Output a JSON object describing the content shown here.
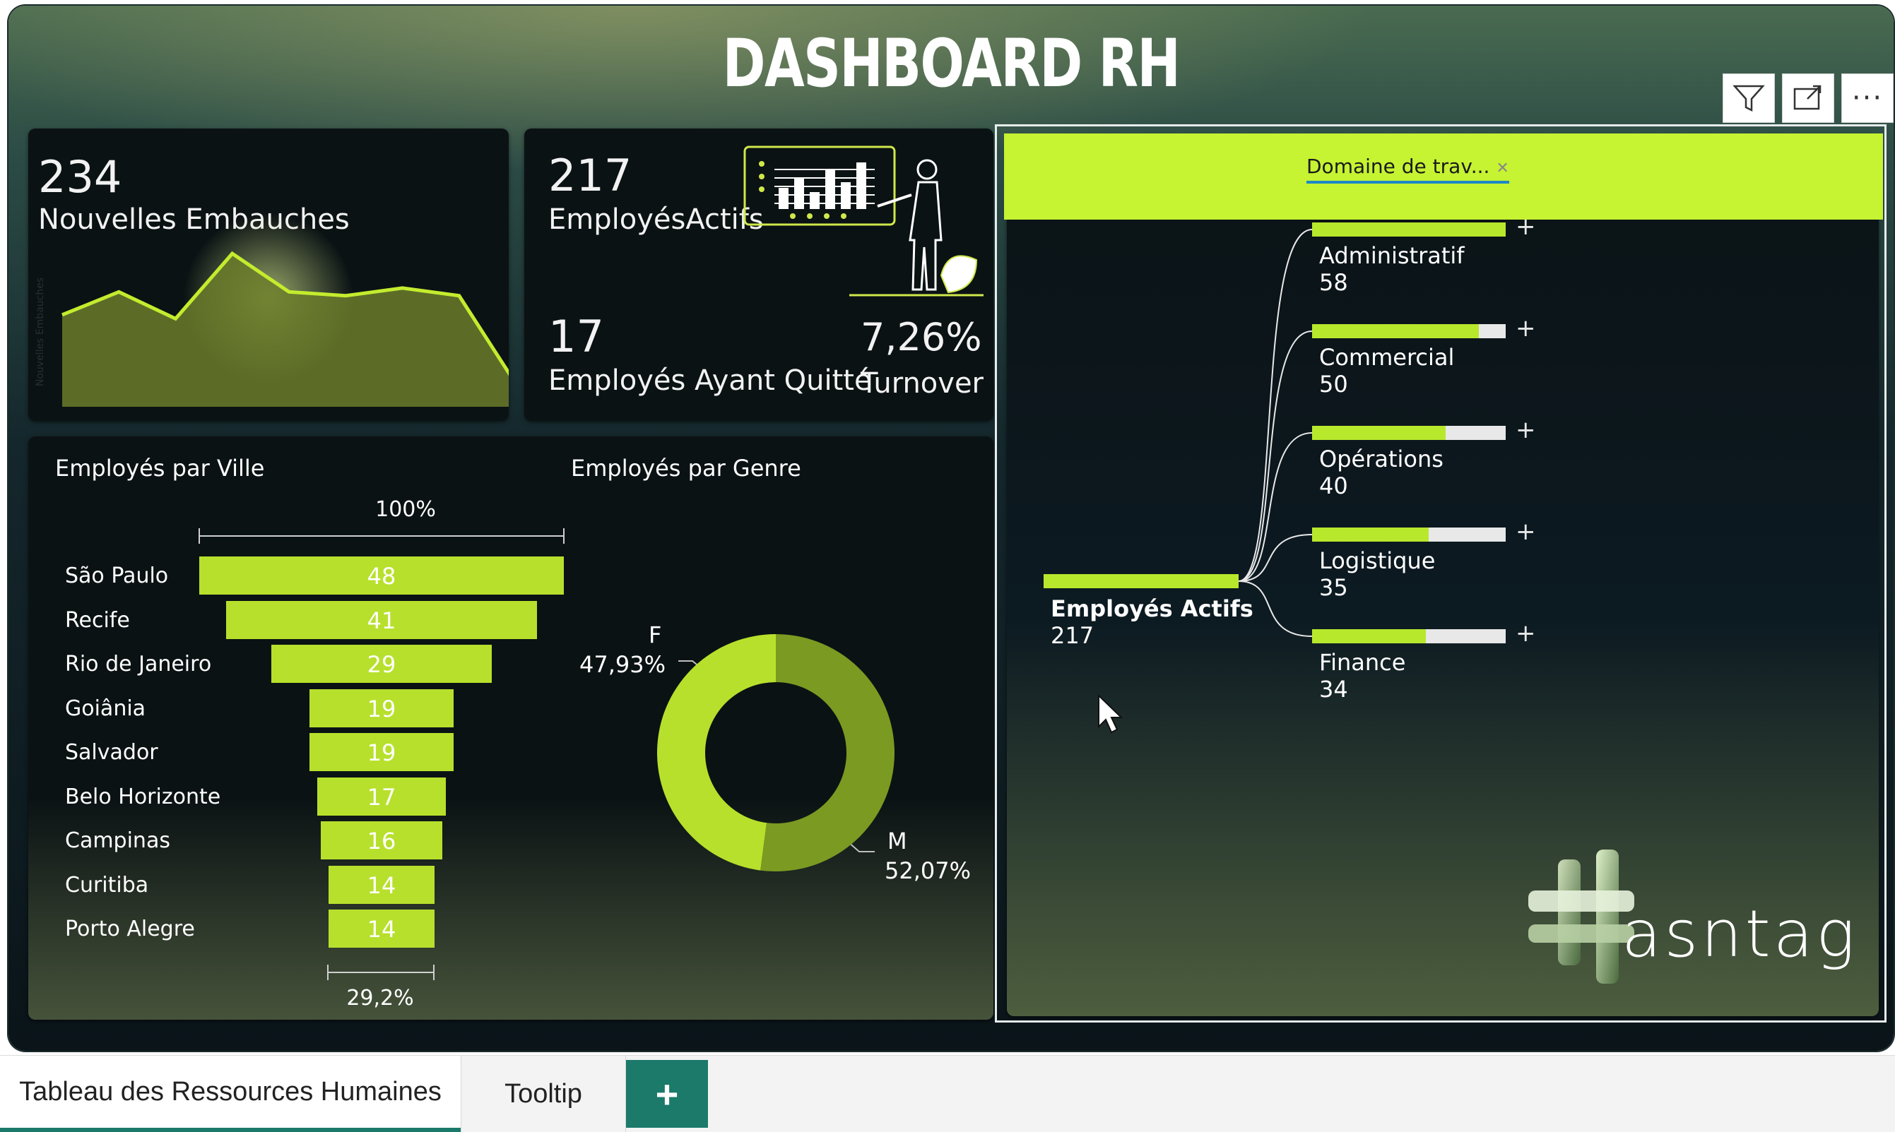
{
  "title": "DASHBOARD RH",
  "kpis": {
    "hires": {
      "value": "234",
      "label": "Nouvelles Embauches",
      "axis_label": "Nouvelles Embauches"
    },
    "active": {
      "value": "217",
      "label": "EmployésActifs"
    },
    "left": {
      "value": "17",
      "label": "Employés Ayant Quitté"
    },
    "turnover": {
      "value": "7,26%",
      "label": "Turnover"
    }
  },
  "funnel": {
    "title": "Employés par Ville",
    "top_pct": "100%",
    "bottom_pct": "29,2%"
  },
  "donut": {
    "title": "Employés par Genre",
    "f_label": "F",
    "f_pct": "47,93%",
    "m_label": "M",
    "m_pct": "52,07%"
  },
  "decomposition": {
    "filter_label": "Domaine de trav...",
    "root_label": "Employés Actifs",
    "root_value": "217"
  },
  "toolbar": {
    "filter_icon": "filter-icon",
    "focus_icon": "focus-mode-icon",
    "more_label": "···"
  },
  "logo": {
    "text": "asntag"
  },
  "tabs": {
    "tab1": "Tableau des Ressources Humaines",
    "tab2": "Tooltip",
    "add": "+"
  },
  "colors": {
    "accent": "#b7e02c",
    "accent_dark": "#7b9a22",
    "tab_active": "#1b7a6a"
  },
  "chart_data": [
    {
      "type": "area",
      "title": "",
      "values": [
        24,
        30,
        23,
        40,
        30,
        29,
        31,
        29,
        6
      ],
      "ylim": [
        0,
        45
      ]
    },
    {
      "type": "bar",
      "title": "Employés par Ville",
      "categories": [
        "São Paulo",
        "Recife",
        "Rio de Janeiro",
        "Goiânia",
        "Salvador",
        "Belo Horizonte",
        "Campinas",
        "Curitiba",
        "Porto Alegre"
      ],
      "values": [
        48,
        41,
        29,
        19,
        19,
        17,
        16,
        14,
        14
      ]
    },
    {
      "type": "pie",
      "title": "Employés par Genre",
      "categories": [
        "F",
        "M"
      ],
      "values": [
        47.93,
        52.07
      ]
    },
    {
      "type": "bar",
      "title": "Domaine de travail",
      "categories": [
        "Administratif",
        "Commercial",
        "Opérations",
        "Logistique",
        "Finance"
      ],
      "values": [
        58,
        50,
        40,
        35,
        34
      ]
    }
  ]
}
